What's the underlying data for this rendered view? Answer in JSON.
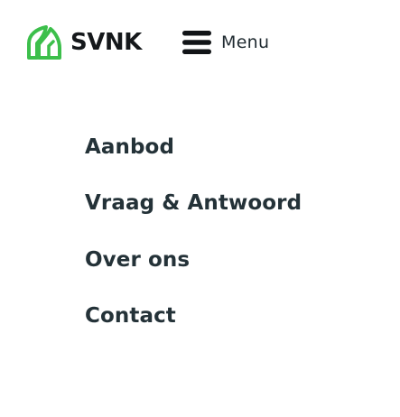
{
  "brand": {
    "name": "SVNK",
    "logo_icon": "leaf-house-icon",
    "logo_color": "#3cbf4b"
  },
  "menu": {
    "icon": "hamburger-icon",
    "label": "Menu"
  },
  "nav": {
    "items": [
      {
        "label": "Aanbod"
      },
      {
        "label": "Vraag & Antwoord"
      },
      {
        "label": "Over ons"
      },
      {
        "label": "Contact"
      }
    ]
  },
  "colors": {
    "background": "#ffffff",
    "text": "#243238",
    "accent": "#3cbf4b"
  }
}
